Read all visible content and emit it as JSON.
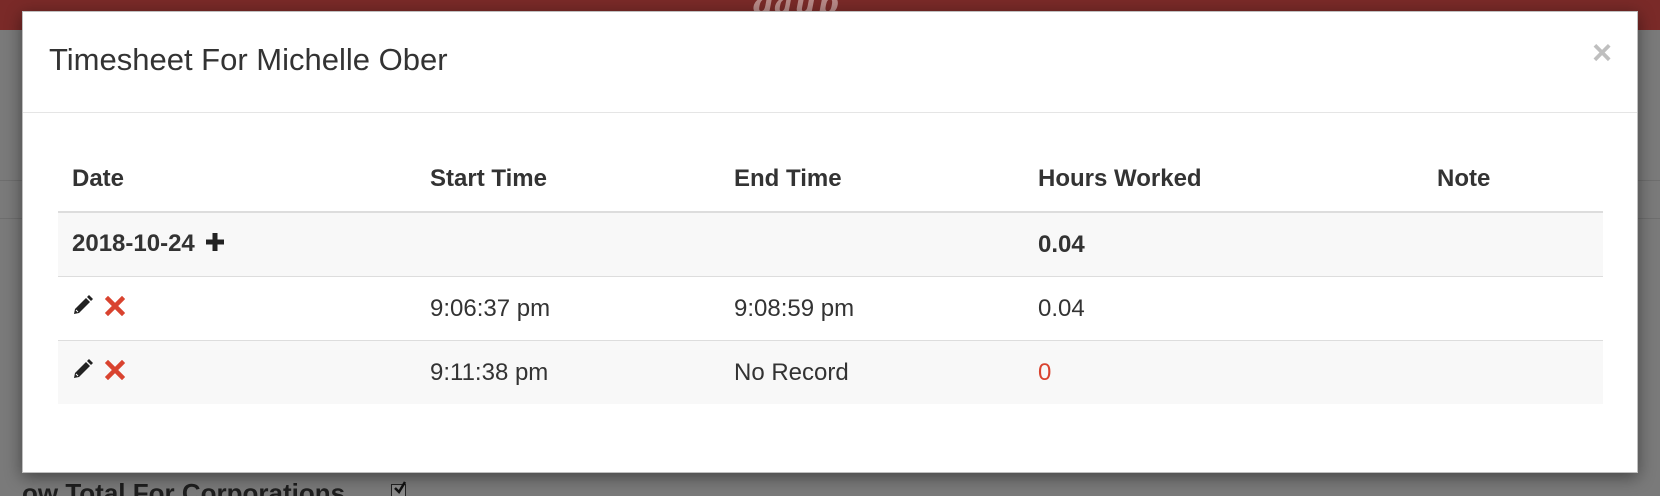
{
  "background": {
    "logo_text": "gaup",
    "bottom_text": "ow Total For Corporations"
  },
  "modal": {
    "title": "Timesheet For Michelle Ober",
    "close_glyph": "×"
  },
  "table": {
    "headers": [
      "Date",
      "Start Time",
      "End Time",
      "Hours Worked",
      "Note"
    ],
    "group": {
      "date": "2018-10-24",
      "hours": "0.04"
    },
    "rows": [
      {
        "start": "9:06:37 pm",
        "end": "9:08:59 pm",
        "hours": "0.04",
        "note": ""
      },
      {
        "start": "9:11:38 pm",
        "end": "No Record",
        "hours": "0",
        "note": ""
      }
    ]
  },
  "icons": {
    "add": "plus-icon",
    "edit": "pencil-icon",
    "delete": "x-icon",
    "close": "close-icon"
  },
  "colors": {
    "header_bar": "#7a2a28",
    "delete_icon": "#d9432f",
    "zero_hours": "#d9432f"
  }
}
